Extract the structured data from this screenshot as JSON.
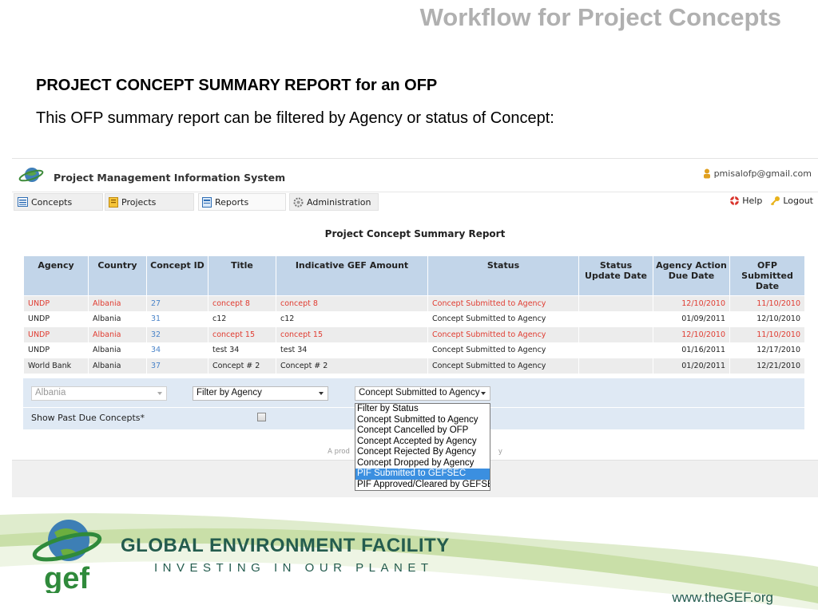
{
  "slide": {
    "title": "Workflow for Project Concepts",
    "heading": "PROJECT CONCEPT SUMMARY REPORT for an OFP",
    "subtitle": "This OFP summary report can be filtered by Agency or status of Concept:"
  },
  "app": {
    "name": "Project Management Information System",
    "user_email": "pmisalofp@gmail.com",
    "nav_tabs": [
      {
        "label": "Concepts",
        "icon": "list-icon"
      },
      {
        "label": "Projects",
        "icon": "folder-icon"
      },
      {
        "label": "Reports",
        "icon": "report-icon"
      },
      {
        "label": "Administration",
        "icon": "gear-icon"
      }
    ],
    "help_label": "Help",
    "logout_label": "Logout"
  },
  "report": {
    "title": "Project Concept Summary Report",
    "columns": [
      "Agency",
      "Country",
      "Concept ID",
      "Title",
      "Indicative GEF Amount",
      "Status",
      "Status Update Date",
      "Agency Action Due Date",
      "OFP Submitted Date"
    ],
    "rows": [
      {
        "agency": "UNDP",
        "country": "Albania",
        "concept_id": "27",
        "title": "concept 8",
        "amount": "concept 8",
        "status": "Concept Submitted to Agency",
        "status_update": "",
        "due_date": "12/10/2010",
        "submitted": "11/10/2010",
        "highlight": true
      },
      {
        "agency": "UNDP",
        "country": "Albania",
        "concept_id": "31",
        "title": "c12",
        "amount": "c12",
        "status": "Concept Submitted to Agency",
        "status_update": "",
        "due_date": "01/09/2011",
        "submitted": "12/10/2010",
        "highlight": false
      },
      {
        "agency": "UNDP",
        "country": "Albania",
        "concept_id": "32",
        "title": "concept 15",
        "amount": "concept 15",
        "status": "Concept Submitted to Agency",
        "status_update": "",
        "due_date": "12/10/2010",
        "submitted": "11/10/2010",
        "highlight": true
      },
      {
        "agency": "UNDP",
        "country": "Albania",
        "concept_id": "34",
        "title": "test 34",
        "amount": "test 34",
        "status": "Concept Submitted to Agency",
        "status_update": "",
        "due_date": "01/16/2011",
        "submitted": "12/17/2010",
        "highlight": false
      },
      {
        "agency": "World Bank",
        "country": "Albania",
        "concept_id": "37",
        "title": "Concept # 2",
        "amount": "Concept # 2",
        "status": "Concept Submitted to Agency",
        "status_update": "",
        "due_date": "01/20/2011",
        "submitted": "12/21/2010",
        "highlight": false
      }
    ]
  },
  "filters": {
    "country_value": "Albania",
    "agency_value": "Filter by Agency",
    "status_value": "Concept Submitted to Agency",
    "past_due_label": "Show Past Due Concepts*",
    "status_options": [
      "Filter by Status",
      "Concept Submitted to Agency",
      "Concept Cancelled by OFP",
      "Concept Accepted by Agency",
      "Concept Rejected By Agency",
      "Concept Dropped by Agency",
      "PIF Submitted to GEFSEC",
      "PIF Approved/Cleared by GEFSEC"
    ],
    "highlighted_option": "PIF Submitted to GEFSEC"
  },
  "footer": {
    "partial_text_left": "A prod",
    "partial_text_right": "y"
  },
  "gef": {
    "logo_text": "gef",
    "name": "GLOBAL ENVIRONMENT FACILITY",
    "tagline": "INVESTING IN OUR PLANET",
    "url": "www.theGEF.org"
  },
  "colors": {
    "header_blue": "#c2d5e9",
    "highlight_red": "#e03c31",
    "id_blue": "#4a84c9",
    "gef_green": "#245c4e"
  }
}
